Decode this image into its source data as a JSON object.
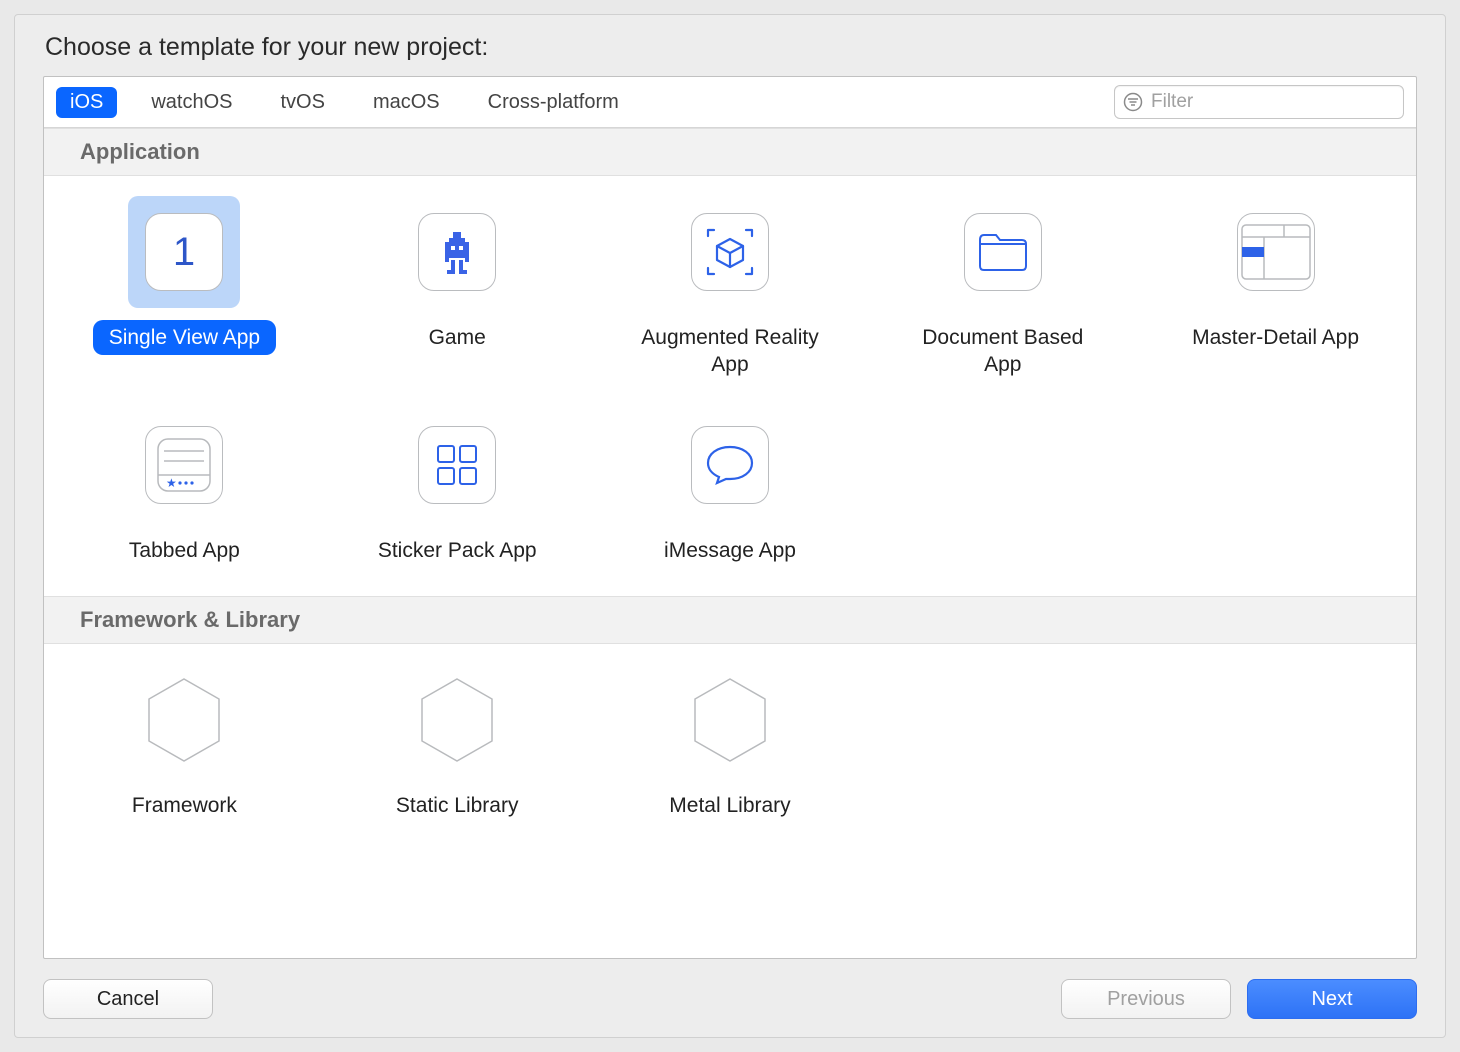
{
  "title": "Choose a template for your new project:",
  "tabs": [
    "iOS",
    "watchOS",
    "tvOS",
    "macOS",
    "Cross-platform"
  ],
  "active_tab": "iOS",
  "filter": {
    "placeholder": "Filter",
    "value": ""
  },
  "sections": [
    {
      "title": "Application",
      "items": [
        {
          "id": "single-view-app",
          "label": "Single View App",
          "icon": "digit-one-icon",
          "selected": true
        },
        {
          "id": "game",
          "label": "Game",
          "icon": "robot-sprite-icon",
          "selected": false
        },
        {
          "id": "augmented-reality-app",
          "label": "Augmented Reality App",
          "icon": "ar-cube-icon",
          "selected": false
        },
        {
          "id": "document-based-app",
          "label": "Document Based App",
          "icon": "folder-icon",
          "selected": false
        },
        {
          "id": "master-detail-app",
          "label": "Master-Detail App",
          "icon": "master-detail-icon",
          "selected": false
        },
        {
          "id": "tabbed-app",
          "label": "Tabbed App",
          "icon": "tabbed-icon",
          "selected": false
        },
        {
          "id": "sticker-pack-app",
          "label": "Sticker Pack App",
          "icon": "sticker-grid-icon",
          "selected": false
        },
        {
          "id": "imessage-app",
          "label": "iMessage App",
          "icon": "speech-bubble-icon",
          "selected": false
        }
      ]
    },
    {
      "title": "Framework & Library",
      "items": [
        {
          "id": "framework",
          "label": "Framework",
          "icon": "toolbox-icon",
          "selected": false
        },
        {
          "id": "static-library",
          "label": "Static Library",
          "icon": "library-building-icon",
          "selected": false
        },
        {
          "id": "metal-library",
          "label": "Metal Library",
          "icon": "metal-m-icon",
          "selected": false
        }
      ]
    }
  ],
  "buttons": {
    "cancel": "Cancel",
    "previous": "Previous",
    "next": "Next"
  }
}
